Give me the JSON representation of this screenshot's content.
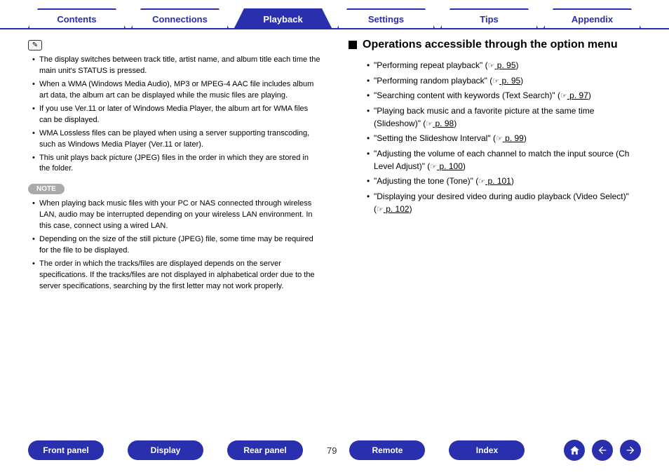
{
  "tabs": {
    "contents": "Contents",
    "connections": "Connections",
    "playback": "Playback",
    "settings": "Settings",
    "tips": "Tips",
    "appendix": "Appendix"
  },
  "left": {
    "info": [
      "The display switches between track title, artist name, and album title each time the main unit's STATUS is pressed.",
      "When a WMA (Windows Media Audio), MP3 or MPEG-4 AAC file includes album art data, the album art can be displayed while the music files are playing.",
      "If you use Ver.11 or later of Windows Media Player, the album art for WMA files can be displayed.",
      "WMA Lossless files can be played when using a server supporting transcoding, such as Windows Media Player (Ver.11 or later).",
      "This unit plays back picture (JPEG) files in the order in which they are stored in the folder."
    ],
    "note_label": "NOTE",
    "notes": [
      "When playing back music files with your PC or NAS connected through wireless LAN, audio may be interrupted depending on your wireless LAN environment. In this case, connect using a wired LAN.",
      "Depending on the size of the still picture (JPEG) file, some time may be required for the file to be displayed.",
      "The order in which the tracks/files are displayed depends on the server specifications. If the tracks/files are not displayed in alphabetical order due to the server specifications, searching by the first letter may not work properly."
    ]
  },
  "right": {
    "heading": "Operations accessible through the option menu",
    "ops": [
      {
        "text": "\"Performing repeat playback\" (",
        "page": " p. 95",
        "suffix": ")"
      },
      {
        "text": "\"Performing random playback\" (",
        "page": " p. 95",
        "suffix": ")"
      },
      {
        "text": "\"Searching content with keywords (Text Search)\" (",
        "page": " p. 97",
        "suffix": ")"
      },
      {
        "text": "\"Playing back music and a favorite picture at the same time (Slideshow)\" (",
        "page": " p. 98",
        "suffix": ")"
      },
      {
        "text": "\"Setting the Slideshow Interval\" (",
        "page": " p. 99",
        "suffix": ")"
      },
      {
        "text": "\"Adjusting the volume of each channel to match the input source (Ch Level Adjust)\" (",
        "page": " p. 100",
        "suffix": ")"
      },
      {
        "text": "\"Adjusting the tone (Tone)\" (",
        "page": " p. 101",
        "suffix": ")"
      },
      {
        "text": "\"Displaying your desired video during audio playback (Video Select)\" (",
        "page": " p. 102",
        "suffix": ")"
      }
    ]
  },
  "bottom": {
    "front_panel": "Front panel",
    "display": "Display",
    "rear_panel": "Rear panel",
    "remote": "Remote",
    "index": "Index",
    "page": "79"
  }
}
